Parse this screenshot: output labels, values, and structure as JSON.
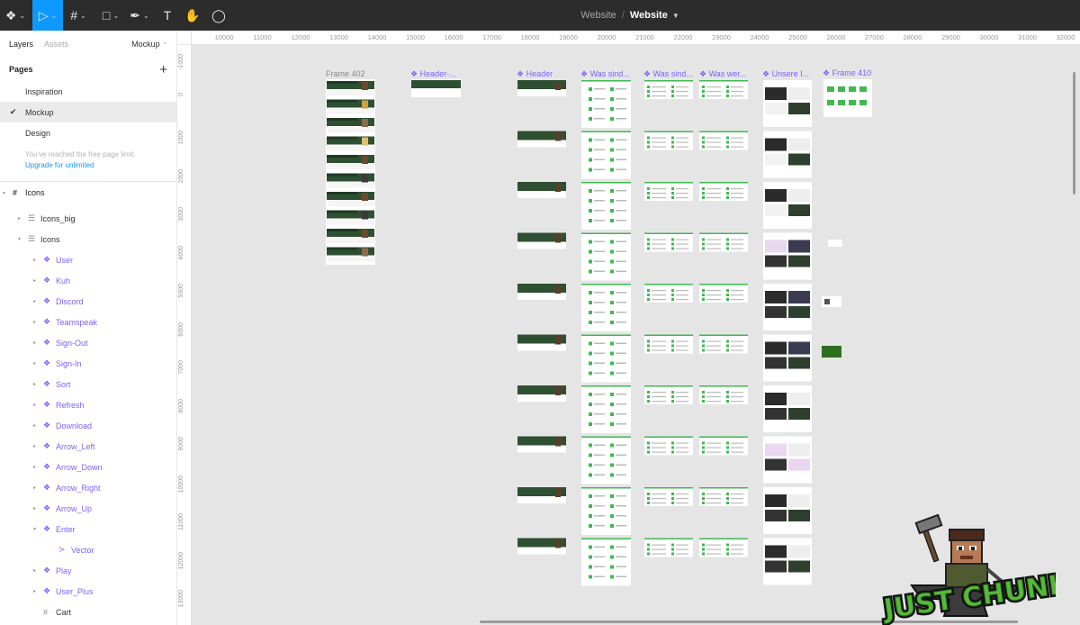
{
  "toolbar": {
    "tools": [
      {
        "name": "main-menu-button",
        "glyph": "❖",
        "caret": true
      },
      {
        "name": "move-tool-button",
        "glyph": "▷",
        "caret": true,
        "active": true
      },
      {
        "name": "frame-tool-button",
        "glyph": "#",
        "caret": true
      },
      {
        "name": "shape-tool-button",
        "glyph": "□",
        "caret": true
      },
      {
        "name": "pen-tool-button",
        "glyph": "✒",
        "caret": true
      },
      {
        "name": "text-tool-button",
        "glyph": "T",
        "caret": false
      },
      {
        "name": "hand-tool-button",
        "glyph": "✋",
        "caret": false
      },
      {
        "name": "comment-tool-button",
        "glyph": "◯",
        "caret": false
      }
    ],
    "project": "Website",
    "separator": "/",
    "file": "Website"
  },
  "left_panel": {
    "tabs": {
      "layers": "Layers",
      "assets": "Assets"
    },
    "current_page": "Mockup",
    "pages_title": "Pages",
    "pages": [
      {
        "label": "Inspiration",
        "selected": false
      },
      {
        "label": "Mockup",
        "selected": true
      },
      {
        "label": "Design",
        "selected": false
      }
    ],
    "limit_text": "You've reached the free page limit.",
    "upgrade_text": "Upgrade for unlimited",
    "layers": [
      {
        "label": "Icons",
        "type": "frame",
        "depth": 0,
        "expanded": true
      },
      {
        "label": "Icons_big",
        "type": "group",
        "depth": 1,
        "expanded": false
      },
      {
        "label": "Icons",
        "type": "group",
        "depth": 1,
        "expanded": true
      },
      {
        "label": "User",
        "type": "component",
        "depth": 2,
        "expanded": false
      },
      {
        "label": "Kuh",
        "type": "component",
        "depth": 2,
        "expanded": false
      },
      {
        "label": "Discord",
        "type": "component",
        "depth": 2,
        "expanded": false
      },
      {
        "label": "Teamspeak",
        "type": "component",
        "depth": 2,
        "expanded": false
      },
      {
        "label": "Sign-Out",
        "type": "component",
        "depth": 2,
        "expanded": false
      },
      {
        "label": "Sign-In",
        "type": "component",
        "depth": 2,
        "expanded": false
      },
      {
        "label": "Sort",
        "type": "component",
        "depth": 2,
        "expanded": false
      },
      {
        "label": "Refresh",
        "type": "component",
        "depth": 2,
        "expanded": false
      },
      {
        "label": "Download",
        "type": "component",
        "depth": 2,
        "expanded": false
      },
      {
        "label": "Arrow_Left",
        "type": "component",
        "depth": 2,
        "expanded": false
      },
      {
        "label": "Arrow_Down",
        "type": "component",
        "depth": 2,
        "expanded": false
      },
      {
        "label": "Arrow_Right",
        "type": "component",
        "depth": 2,
        "expanded": false
      },
      {
        "label": "Arrow_Up",
        "type": "component",
        "depth": 2,
        "expanded": false
      },
      {
        "label": "Enter",
        "type": "component",
        "depth": 2,
        "expanded": true
      },
      {
        "label": "Vector",
        "type": "vector",
        "depth": 3,
        "expanded": false
      },
      {
        "label": "Play",
        "type": "component",
        "depth": 2,
        "expanded": false
      },
      {
        "label": "User_Plus",
        "type": "component",
        "depth": 2,
        "expanded": false
      },
      {
        "label": "Cart",
        "type": "frame-plain",
        "depth": 2,
        "expanded": false
      }
    ]
  },
  "canvas": {
    "ruler_x": [
      "10000",
      "11000",
      "12000",
      "13000",
      "14000",
      "15000",
      "16000",
      "17000",
      "18000",
      "19000",
      "20000",
      "21000",
      "22000",
      "23000",
      "24000",
      "25000",
      "26000",
      "27000",
      "28000",
      "29000",
      "30000",
      "31000",
      "32000"
    ],
    "ruler_y": [
      "-1000",
      "0",
      "1000",
      "2000",
      "3000",
      "4000",
      "5000",
      "6000",
      "7000",
      "8000",
      "9000",
      "10000",
      "11000",
      "12000",
      "13000"
    ],
    "frame_labels": [
      {
        "text": "Frame 402",
        "component": false
      },
      {
        "text": "Header-...",
        "component": true
      },
      {
        "text": "Header",
        "component": true
      },
      {
        "text": "Was sind...",
        "component": true
      },
      {
        "text": "Was sind...",
        "component": true
      },
      {
        "text": "Was wer...",
        "component": true
      },
      {
        "text": "Unsere I...",
        "component": true
      },
      {
        "text": "Frame 410",
        "component": true
      }
    ],
    "logo_text": "JUST CHUNKS"
  }
}
